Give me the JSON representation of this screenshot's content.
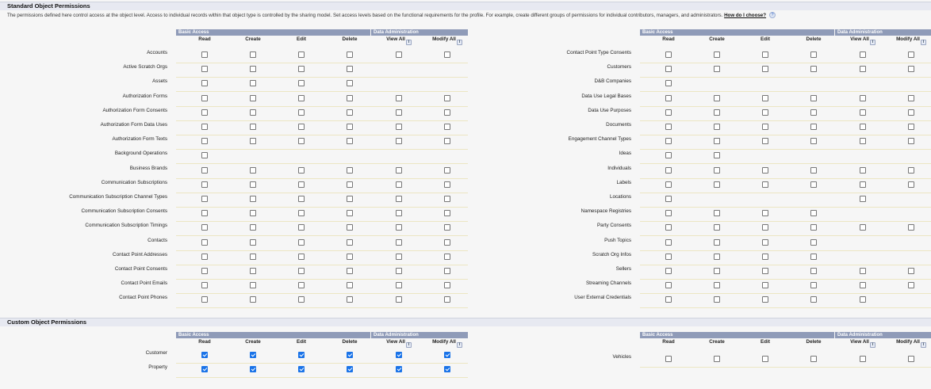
{
  "standard": {
    "title": "Standard Object Permissions",
    "description": "The permissions defined here control access at the object level. Access to individual records within that object type is controlled by the sharing model. Set access levels based on the functional requirements for the profile. For example, create different groups of permissions for individual contributors, managers, and administrators.",
    "help_link": "How do I choose?",
    "help_icon": "?"
  },
  "custom": {
    "title": "Custom Object Permissions"
  },
  "groups": {
    "basic": "Basic Access",
    "admin": "Data Administration"
  },
  "columns": [
    "Read",
    "Create",
    "Edit",
    "Delete",
    "View All",
    "Modify All"
  ],
  "info_icon": "i",
  "standard_left": [
    {
      "label": "Accounts",
      "checks": [
        0,
        0,
        0,
        0,
        0,
        0
      ]
    },
    {
      "label": "Active Scratch Orgs",
      "checks": [
        0,
        0,
        0,
        0,
        null,
        null
      ]
    },
    {
      "label": "Assets",
      "checks": [
        0,
        0,
        0,
        0,
        null,
        null
      ]
    },
    {
      "label": "Authorization Forms",
      "checks": [
        0,
        0,
        0,
        0,
        0,
        0
      ]
    },
    {
      "label": "Authorization Form Consents",
      "checks": [
        0,
        0,
        0,
        0,
        0,
        0
      ]
    },
    {
      "label": "Authorization Form Data Uses",
      "checks": [
        0,
        0,
        0,
        0,
        0,
        0
      ]
    },
    {
      "label": "Authorization Form Texts",
      "checks": [
        0,
        0,
        0,
        0,
        0,
        0
      ]
    },
    {
      "label": "Background Operations",
      "checks": [
        0,
        null,
        null,
        null,
        null,
        null
      ]
    },
    {
      "label": "Business Brands",
      "checks": [
        0,
        0,
        0,
        0,
        0,
        0
      ]
    },
    {
      "label": "Communication Subscriptions",
      "checks": [
        0,
        0,
        0,
        0,
        0,
        0
      ]
    },
    {
      "label": "Communication Subscription Channel Types",
      "checks": [
        0,
        0,
        0,
        0,
        0,
        0
      ]
    },
    {
      "label": "Communication Subscription Consents",
      "checks": [
        0,
        0,
        0,
        0,
        0,
        0
      ]
    },
    {
      "label": "Communication Subscription Timings",
      "checks": [
        0,
        0,
        0,
        0,
        0,
        0
      ]
    },
    {
      "label": "Contacts",
      "checks": [
        0,
        0,
        0,
        0,
        0,
        0
      ]
    },
    {
      "label": "Contact Point Addresses",
      "checks": [
        0,
        0,
        0,
        0,
        0,
        0
      ]
    },
    {
      "label": "Contact Point Consents",
      "checks": [
        0,
        0,
        0,
        0,
        0,
        0
      ]
    },
    {
      "label": "Contact Point Emails",
      "checks": [
        0,
        0,
        0,
        0,
        0,
        0
      ]
    },
    {
      "label": "Contact Point Phones",
      "checks": [
        0,
        0,
        0,
        0,
        0,
        0
      ]
    }
  ],
  "standard_right": [
    {
      "label": "Contact Point Type Consents",
      "checks": [
        0,
        0,
        0,
        0,
        0,
        0
      ]
    },
    {
      "label": "Customers",
      "checks": [
        0,
        0,
        0,
        0,
        0,
        0
      ]
    },
    {
      "label": "D&B Companies",
      "checks": [
        0,
        null,
        null,
        null,
        null,
        null
      ]
    },
    {
      "label": "Data Use Legal Bases",
      "checks": [
        0,
        0,
        0,
        0,
        0,
        0
      ]
    },
    {
      "label": "Data Use Purposes",
      "checks": [
        0,
        0,
        0,
        0,
        0,
        0
      ]
    },
    {
      "label": "Documents",
      "checks": [
        0,
        0,
        0,
        0,
        0,
        0
      ]
    },
    {
      "label": "Engagement Channel Types",
      "checks": [
        0,
        0,
        0,
        0,
        0,
        0
      ]
    },
    {
      "label": "Ideas",
      "checks": [
        0,
        0,
        null,
        null,
        null,
        null
      ]
    },
    {
      "label": "Individuals",
      "checks": [
        0,
        0,
        0,
        0,
        0,
        0
      ]
    },
    {
      "label": "Labels",
      "checks": [
        0,
        0,
        0,
        0,
        0,
        0
      ]
    },
    {
      "label": "Locations",
      "checks": [
        0,
        null,
        null,
        null,
        0,
        null
      ]
    },
    {
      "label": "Namespace Registries",
      "checks": [
        0,
        0,
        0,
        0,
        null,
        null
      ]
    },
    {
      "label": "Party Consents",
      "checks": [
        0,
        0,
        0,
        0,
        0,
        0
      ]
    },
    {
      "label": "Push Topics",
      "checks": [
        0,
        0,
        0,
        0,
        null,
        null
      ]
    },
    {
      "label": "Scratch Org Infos",
      "checks": [
        0,
        0,
        0,
        0,
        null,
        null
      ]
    },
    {
      "label": "Sellers",
      "checks": [
        0,
        0,
        0,
        0,
        0,
        0
      ]
    },
    {
      "label": "Streaming Channels",
      "checks": [
        0,
        0,
        0,
        0,
        0,
        0
      ]
    },
    {
      "label": "User External Credentials",
      "checks": [
        0,
        0,
        0,
        0,
        0,
        null
      ]
    }
  ],
  "custom_left": [
    {
      "label": "Customer",
      "checks": [
        1,
        1,
        1,
        1,
        1,
        1
      ]
    },
    {
      "label": "Property",
      "checks": [
        1,
        1,
        1,
        1,
        1,
        1
      ]
    }
  ],
  "custom_right": [
    {
      "label": "Vehicles",
      "checks": [
        0,
        0,
        0,
        0,
        0,
        0
      ]
    }
  ]
}
